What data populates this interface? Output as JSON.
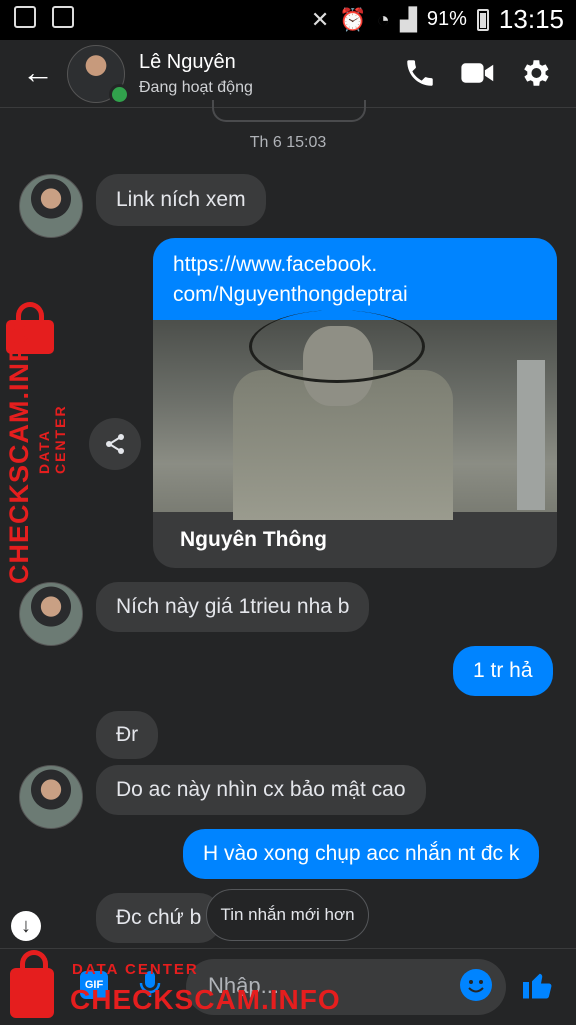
{
  "status_bar": {
    "battery": "91%",
    "time": "13:15"
  },
  "header": {
    "name": "Lê Nguyên",
    "status": "Đang hoạt động"
  },
  "timestamp": "Th 6 15:03",
  "messages": [
    {
      "from": "them",
      "text": "Link ních xem"
    },
    {
      "from": "me",
      "type": "link",
      "url_line1": "https://www.facebook.",
      "url_line2": "com/Nguyenthongdeptrai",
      "title": "Nguyên Thông"
    },
    {
      "from": "them",
      "text": "Ních này giá 1trieu nha b"
    },
    {
      "from": "me",
      "text": "1 tr hả"
    },
    {
      "from": "them",
      "text": "Đr"
    },
    {
      "from": "them",
      "text": "Do ac này nhìn cx bảo mật cao"
    },
    {
      "from": "me",
      "text": "H vào xong chụp acc nhắn nt đc k"
    },
    {
      "from": "them",
      "text": "Đc chứ b"
    }
  ],
  "newer_messages": "Tin nhắn mới hơn",
  "composer": {
    "placeholder": "Nhập...",
    "gif_label": "GIF"
  },
  "watermark": {
    "side_big": "CHECKSCAM.INFO",
    "side_small": "DATA CENTER",
    "bottom_small": "DATA CENTER",
    "bottom_big": "CHECKSCAM.INFO"
  },
  "colors": {
    "background": "#242526",
    "bubble_in": "#3a3b3c",
    "bubble_out": "#0084ff",
    "online": "#31a24c",
    "watermark": "#e51e1e"
  },
  "icons": [
    "back-arrow-icon",
    "phone-icon",
    "video-icon",
    "gear-icon",
    "share-icon",
    "arrow-down-icon",
    "gif-icon",
    "mic-icon",
    "emoji-icon",
    "like-icon"
  ]
}
